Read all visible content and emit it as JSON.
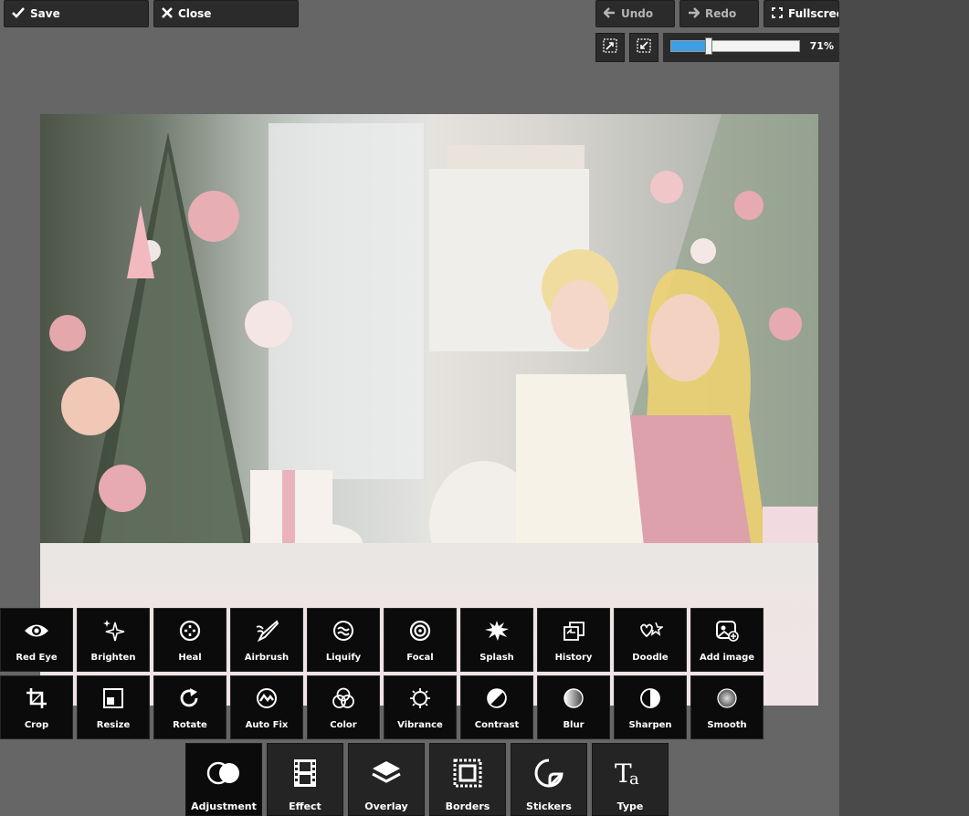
{
  "toolbar": {
    "save_label": "Save",
    "close_label": "Close",
    "undo_label": "Undo",
    "redo_label": "Redo",
    "fullscreen_label": "Fullscreen"
  },
  "zoom": {
    "percent": 71,
    "label": "71%"
  },
  "tools_row1": [
    {
      "label": "Red Eye",
      "icon": "eye-icon"
    },
    {
      "label": "Brighten",
      "icon": "sparkle-icon"
    },
    {
      "label": "Heal",
      "icon": "heal-icon"
    },
    {
      "label": "Airbrush",
      "icon": "airbrush-icon"
    },
    {
      "label": "Liquify",
      "icon": "liquify-icon"
    },
    {
      "label": "Focal",
      "icon": "focal-icon"
    },
    {
      "label": "Splash",
      "icon": "splash-icon"
    },
    {
      "label": "History",
      "icon": "history-icon"
    },
    {
      "label": "Doodle",
      "icon": "doodle-icon"
    },
    {
      "label": "Add image",
      "icon": "add-image-icon"
    }
  ],
  "tools_row2": [
    {
      "label": "Crop",
      "icon": "crop-icon"
    },
    {
      "label": "Resize",
      "icon": "resize-icon"
    },
    {
      "label": "Rotate",
      "icon": "rotate-icon"
    },
    {
      "label": "Auto Fix",
      "icon": "auto-fix-icon"
    },
    {
      "label": "Color",
      "icon": "color-icon"
    },
    {
      "label": "Vibrance",
      "icon": "vibrance-icon"
    },
    {
      "label": "Contrast",
      "icon": "contrast-icon"
    },
    {
      "label": "Blur",
      "icon": "blur-icon"
    },
    {
      "label": "Sharpen",
      "icon": "sharpen-icon"
    },
    {
      "label": "Smooth",
      "icon": "smooth-icon"
    }
  ],
  "categories": [
    {
      "label": "Adjustment",
      "icon": "adjustment-icon",
      "active": true
    },
    {
      "label": "Effect",
      "icon": "film-icon",
      "active": false
    },
    {
      "label": "Overlay",
      "icon": "layers-icon",
      "active": false
    },
    {
      "label": "Borders",
      "icon": "borders-icon",
      "active": false
    },
    {
      "label": "Stickers",
      "icon": "sticker-icon",
      "active": false
    },
    {
      "label": "Type",
      "icon": "type-icon",
      "active": false
    }
  ],
  "colors": {
    "accent": "#3d9fe3",
    "canvas": "#666666",
    "panel": "#4a4a4a"
  }
}
